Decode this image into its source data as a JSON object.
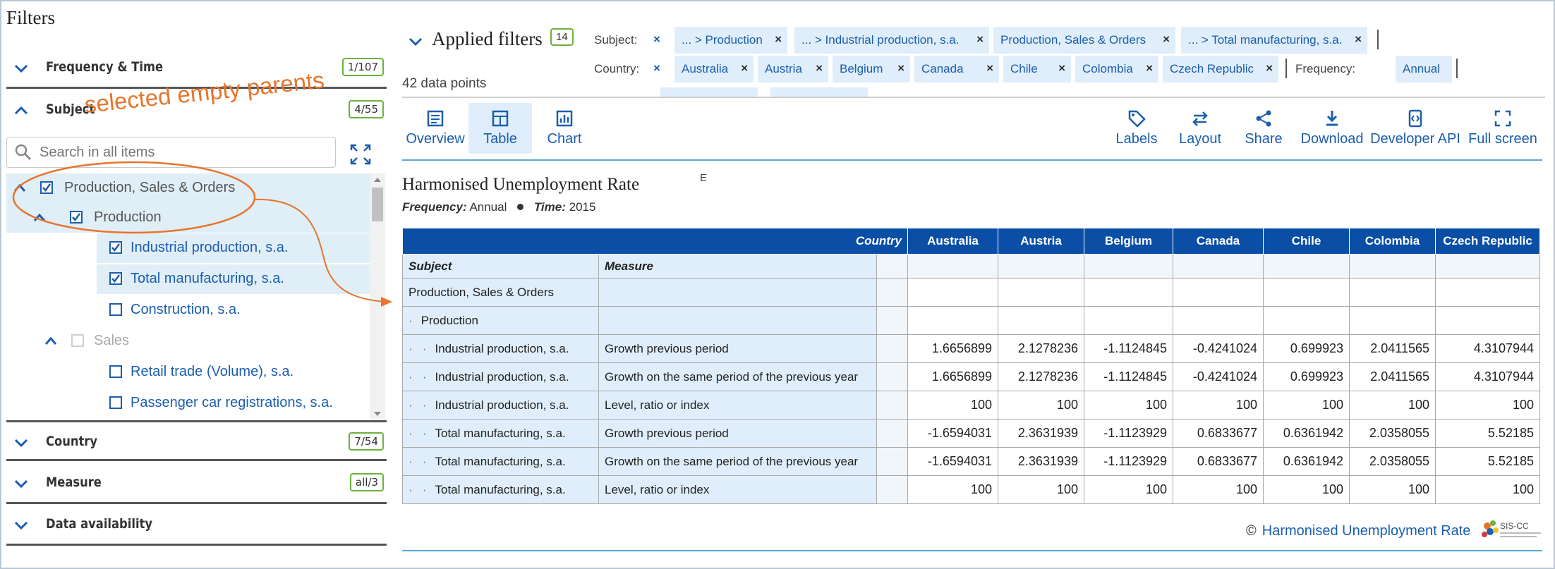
{
  "filters": {
    "title": "Filters",
    "sections": [
      {
        "label": "Frequency & Time",
        "badge": "1/107"
      },
      {
        "label": "Subject",
        "badge": "4/55"
      },
      {
        "label": "Country",
        "badge": "7/54"
      },
      {
        "label": "Measure",
        "badge": "all/3"
      },
      {
        "label": "Data availability",
        "badge": ""
      }
    ],
    "search_placeholder": "Search in all items",
    "tree": [
      {
        "label": "Production, Sales & Orders",
        "checked": true
      },
      {
        "label": "Production",
        "checked": true
      },
      {
        "label": "Industrial production, s.a.",
        "checked": true
      },
      {
        "label": "Total manufacturing, s.a.",
        "checked": true
      },
      {
        "label": "Construction, s.a.",
        "checked": false
      },
      {
        "label": "Sales",
        "checked": false
      },
      {
        "label": "Retail trade (Volume), s.a.",
        "checked": false
      },
      {
        "label": "Passenger car registrations, s.a.",
        "checked": false
      }
    ]
  },
  "annotation": {
    "text": "selected empty parents",
    "color": "#e8742a"
  },
  "applied": {
    "title": "Applied filters",
    "badge": "14",
    "data_points": "42 data points",
    "subject_key": "Subject:",
    "subject_chips": [
      "... > Production",
      "... > Industrial production, s.a.",
      "Production, Sales & Orders",
      "... > Total manufacturing, s.a."
    ],
    "country_key": "Country:",
    "country_chips": [
      "Australia",
      "Austria",
      "Belgium",
      "Canada",
      "Chile",
      "Colombia",
      "Czech Republic"
    ],
    "frequency_key": "Frequency:",
    "frequency_chip": "Annual",
    "x": "×"
  },
  "toolbar": {
    "overview": "Overview",
    "table": "Table",
    "chart": "Chart",
    "labels": "Labels",
    "layout": "Layout",
    "share": "Share",
    "download": "Download",
    "api": "Developer API",
    "fullscreen": "Full screen"
  },
  "table": {
    "title": "Harmonised Unemployment Rate",
    "flag": "E",
    "freq_key": "Frequency:",
    "freq_val": "Annual",
    "time_key": "Time:",
    "time_val": "2015",
    "country_header": "Country",
    "subject_header": "Subject",
    "measure_header": "Measure",
    "countries": [
      "Australia",
      "Austria",
      "Belgium",
      "Canada",
      "Chile",
      "Colombia",
      "Czech Republic"
    ],
    "rows": [
      {
        "indent": "",
        "subject": "Production, Sales & Orders",
        "measure": "",
        "values": [
          "",
          "",
          "",
          "",
          "",
          "",
          ""
        ]
      },
      {
        "indent": "·",
        "subject": "Production",
        "measure": "",
        "values": [
          "",
          "",
          "",
          "",
          "",
          "",
          ""
        ]
      },
      {
        "indent": "·   ·",
        "subject": "Industrial production, s.a.",
        "measure": "Growth previous period",
        "values": [
          "1.6656899",
          "2.1278236",
          "-1.1124845",
          "-0.4241024",
          "0.699923",
          "2.0411565",
          "4.3107944"
        ]
      },
      {
        "indent": "·   ·",
        "subject": "Industrial production, s.a.",
        "measure": "Growth on the same period of the previous year",
        "values": [
          "1.6656899",
          "2.1278236",
          "-1.1124845",
          "-0.4241024",
          "0.699923",
          "2.0411565",
          "4.3107944"
        ]
      },
      {
        "indent": "·   ·",
        "subject": "Industrial production, s.a.",
        "measure": "Level, ratio or index",
        "values": [
          "100",
          "100",
          "100",
          "100",
          "100",
          "100",
          "100"
        ]
      },
      {
        "indent": "·   ·",
        "subject": "Total manufacturing, s.a.",
        "measure": "Growth previous period",
        "values": [
          "-1.6594031",
          "2.3631939",
          "-1.1123929",
          "0.6833677",
          "0.6361942",
          "2.0358055",
          "5.52185"
        ]
      },
      {
        "indent": "·   ·",
        "subject": "Total manufacturing, s.a.",
        "measure": "Growth on the same period of the previous year",
        "values": [
          "-1.6594031",
          "2.3631939",
          "-1.1123929",
          "0.6833677",
          "0.6361942",
          "2.0358055",
          "5.52185"
        ]
      },
      {
        "indent": "·   ·",
        "subject": "Total manufacturing, s.a.",
        "measure": "Level, ratio or index",
        "values": [
          "100",
          "100",
          "100",
          "100",
          "100",
          "100",
          "100"
        ]
      }
    ],
    "copyright_symbol": "©",
    "copyright_link": "Harmonised Unemployment Rate",
    "logo_text": "SIS-CC"
  }
}
